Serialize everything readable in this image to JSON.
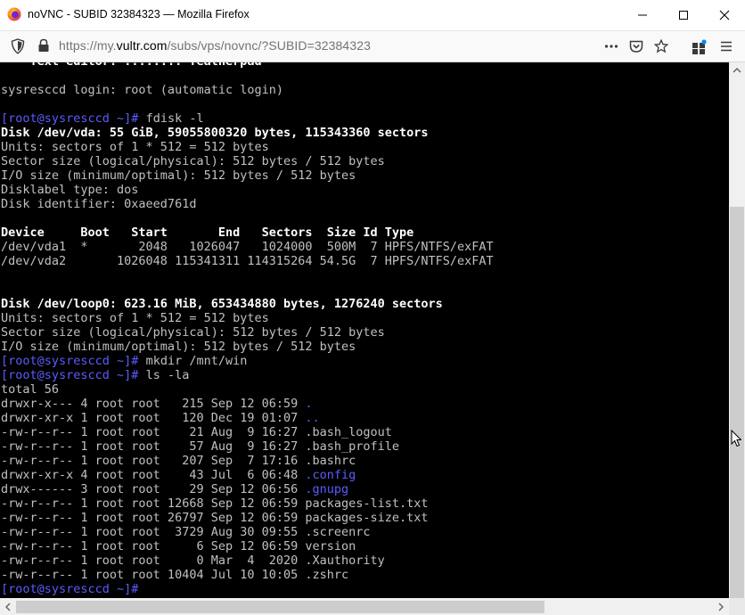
{
  "window": {
    "title": "noVNC - SUBID 32384323 — Mozilla Firefox"
  },
  "navbar": {
    "url_prefix": "https://my.",
    "url_host": "vultr.com",
    "url_path": "/subs/vps/novnc/?SUBID=32384323"
  },
  "icons": {
    "logo": "firefox-logo",
    "tracking": "shield-icon",
    "security": "lock-icon",
    "page_actions": "more-icon",
    "pocket": "pocket-icon",
    "bookmark": "star-icon",
    "extensions": "puzzle-icon",
    "menu": "hamburger-icon"
  },
  "terminal": {
    "prompt": "[root@sysresccd ~]#",
    "lines": [
      {
        "t": "  - Text editor: ........ featherpad",
        "cls": "bold",
        "hot": "-"
      },
      {
        "t": "",
        "cls": ""
      },
      {
        "t": "sysresccd login: root (automatic login)",
        "cls": ""
      },
      {
        "t": "",
        "cls": ""
      },
      {
        "cmd": " fdisk -l"
      },
      {
        "t": "Disk /dev/vda: 55 GiB, 59055800320 bytes, 115343360 sectors",
        "cls": "bold"
      },
      {
        "t": "Units: sectors of 1 * 512 = 512 bytes",
        "cls": ""
      },
      {
        "t": "Sector size (logical/physical): 512 bytes / 512 bytes",
        "cls": ""
      },
      {
        "t": "I/O size (minimum/optimal): 512 bytes / 512 bytes",
        "cls": ""
      },
      {
        "t": "Disklabel type: dos",
        "cls": ""
      },
      {
        "t": "Disk identifier: 0xaeed761d",
        "cls": ""
      },
      {
        "t": "",
        "cls": ""
      },
      {
        "t": "Device     Boot   Start       End   Sectors  Size Id Type",
        "cls": "bold"
      },
      {
        "t": "/dev/vda1  *       2048   1026047   1024000  500M  7 HPFS/NTFS/exFAT",
        "cls": ""
      },
      {
        "t": "/dev/vda2       1026048 115341311 114315264 54.5G  7 HPFS/NTFS/exFAT",
        "cls": ""
      },
      {
        "t": "",
        "cls": ""
      },
      {
        "t": "",
        "cls": ""
      },
      {
        "t": "Disk /dev/loop0: 623.16 MiB, 653434880 bytes, 1276240 sectors",
        "cls": "bold"
      },
      {
        "t": "Units: sectors of 1 * 512 = 512 bytes",
        "cls": ""
      },
      {
        "t": "Sector size (logical/physical): 512 bytes / 512 bytes",
        "cls": ""
      },
      {
        "t": "I/O size (minimum/optimal): 512 bytes / 512 bytes",
        "cls": ""
      },
      {
        "cmd": " mkdir /mnt/win"
      },
      {
        "cmd": " ls -la"
      },
      {
        "t": "total 56",
        "cls": ""
      },
      {
        "t": "drwxr-x--- 4 root root   215 Sep 12 06:59 ",
        "cls": "",
        "dir": "."
      },
      {
        "t": "drwxr-xr-x 1 root root   120 Dec 19 01:07 ",
        "cls": "",
        "dir": ".."
      },
      {
        "t": "-rw-r--r-- 1 root root    21 Aug  9 16:27 .bash_logout",
        "cls": ""
      },
      {
        "t": "-rw-r--r-- 1 root root    57 Aug  9 16:27 .bash_profile",
        "cls": ""
      },
      {
        "t": "-rw-r--r-- 1 root root   207 Sep  7 17:16 .bashrc",
        "cls": ""
      },
      {
        "t": "drwxr-xr-x 4 root root    43 Jul  6 06:48 ",
        "cls": "",
        "dir": ".config"
      },
      {
        "t": "drwx------ 3 root root    29 Sep 12 06:56 ",
        "cls": "",
        "dir": ".gnupg"
      },
      {
        "t": "-rw-r--r-- 1 root root 12668 Sep 12 06:59 packages-list.txt",
        "cls": ""
      },
      {
        "t": "-rw-r--r-- 1 root root 26797 Sep 12 06:59 packages-size.txt",
        "cls": ""
      },
      {
        "t": "-rw-r--r-- 1 root root  3729 Aug 30 09:55 .screenrc",
        "cls": ""
      },
      {
        "t": "-rw-r--r-- 1 root root     6 Sep 12 06:59 version",
        "cls": ""
      },
      {
        "t": "-rw-r--r-- 1 root root     0 Mar  4  2020 .Xauthority",
        "cls": ""
      },
      {
        "t": "-rw-r--r-- 1 root root 10404 Jul 10 10:05 .zshrc",
        "cls": ""
      },
      {
        "cmd": ""
      }
    ]
  }
}
